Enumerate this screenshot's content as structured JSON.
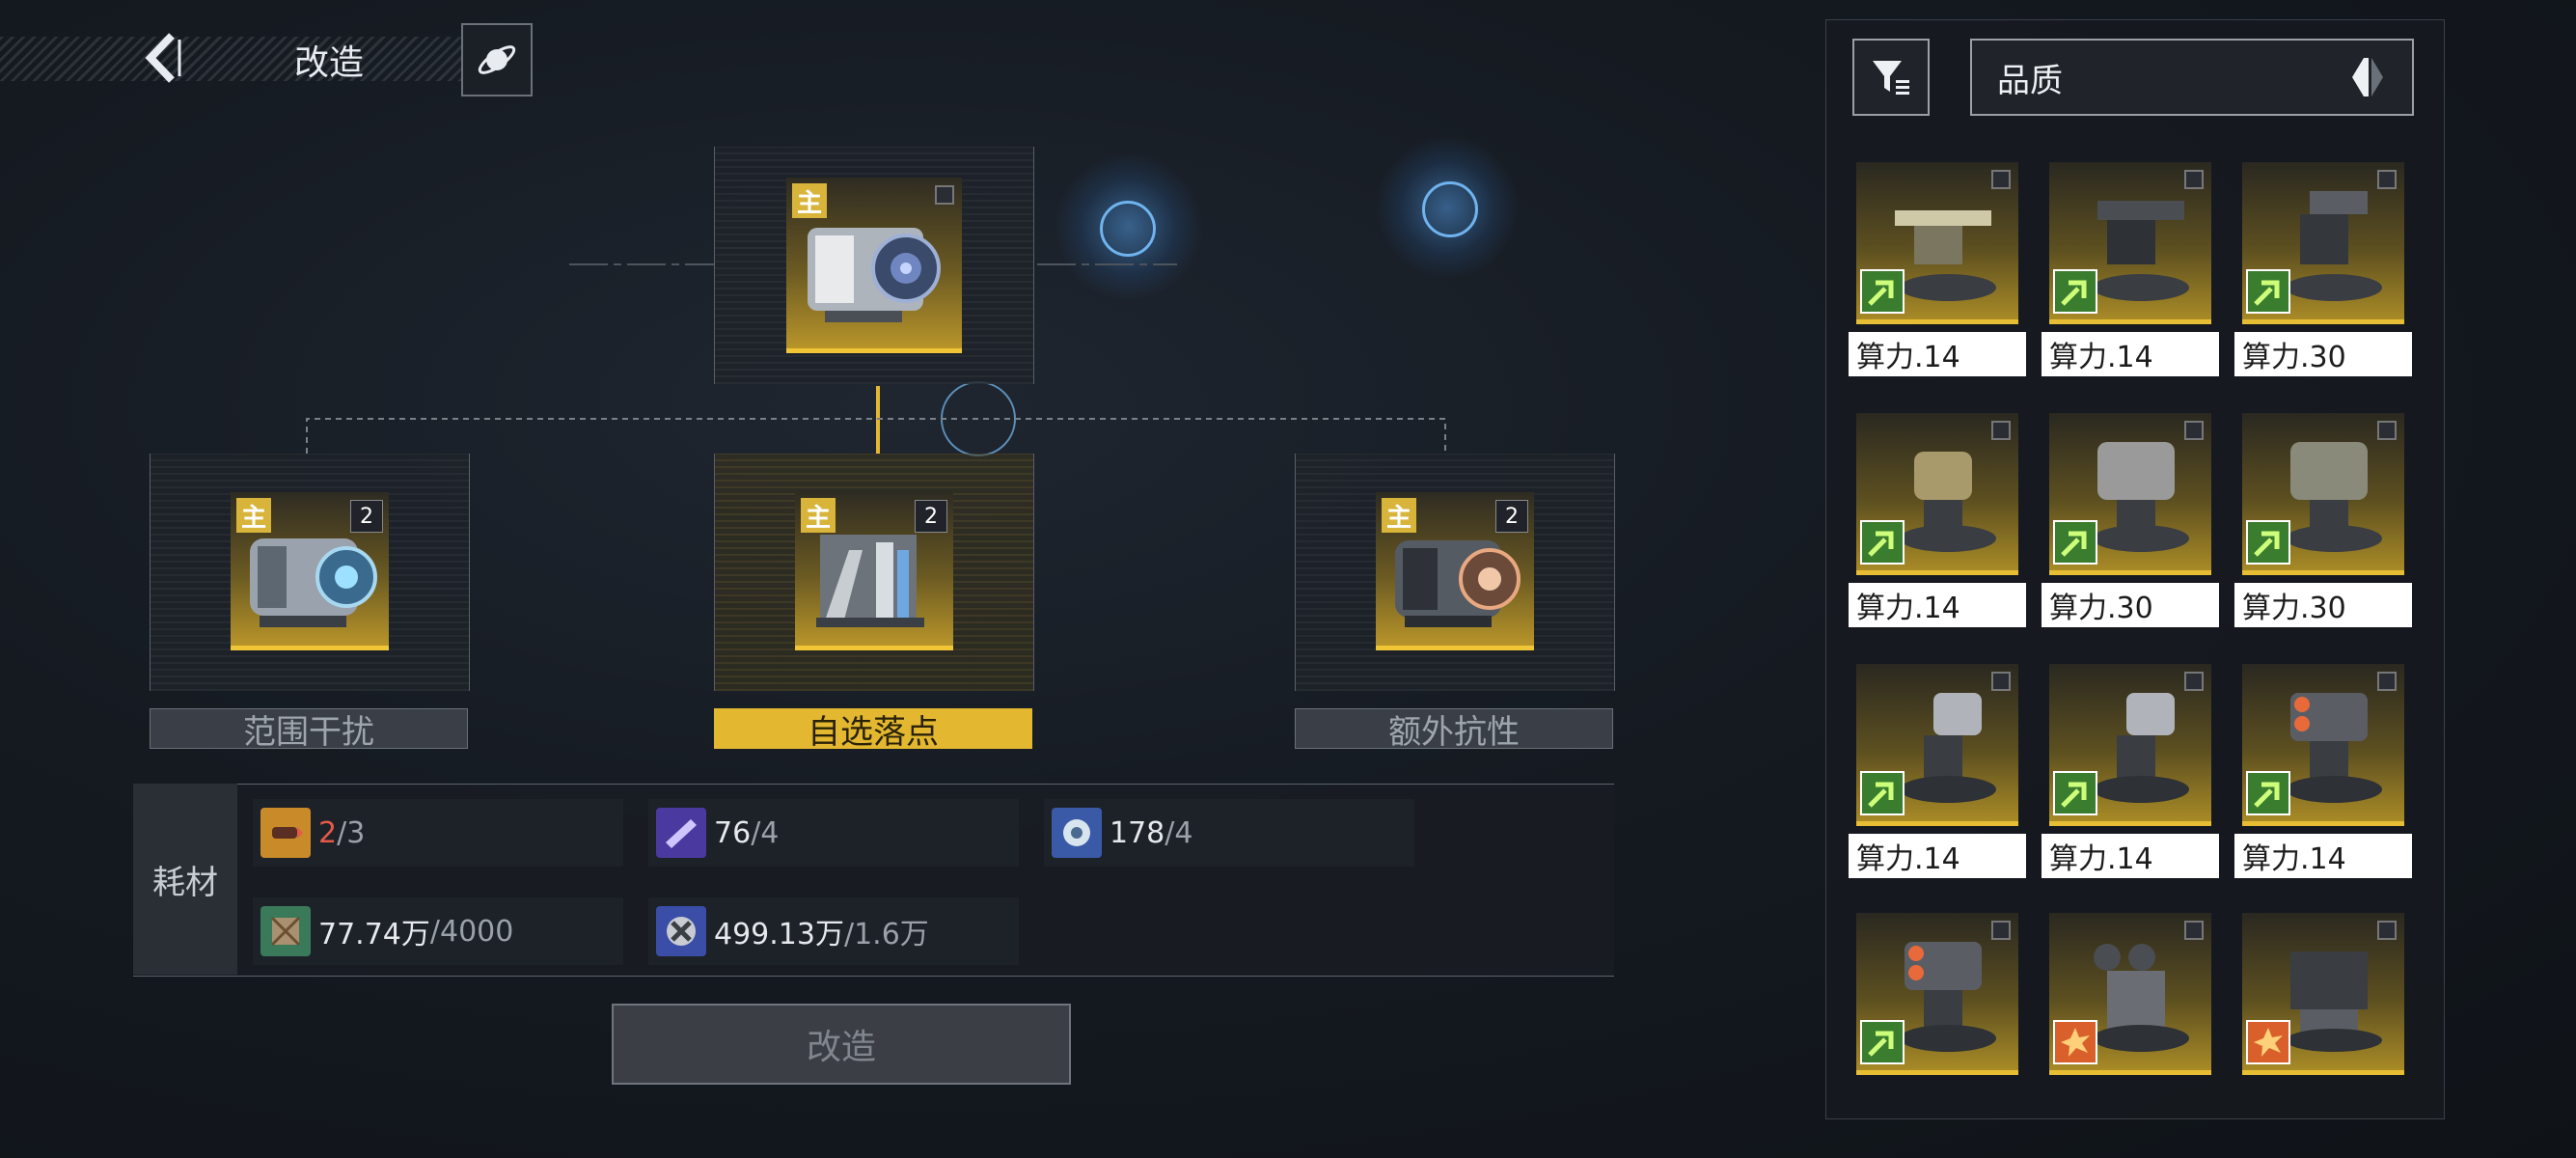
{
  "header": {
    "title": "改造"
  },
  "slots": [
    {
      "label": "范围干扰",
      "main_tag": "主",
      "count": "2",
      "active": false
    },
    {
      "label": "自选落点",
      "main_tag": "主",
      "count": "2",
      "active": true
    },
    {
      "label": "额外抗性",
      "main_tag": "主",
      "count": "2",
      "active": false
    }
  ],
  "top_item": {
    "main_tag": "主"
  },
  "materials": {
    "label": "耗材",
    "items": [
      {
        "have": "2",
        "need": "/3",
        "icon": "missile-icon"
      },
      {
        "have": "76",
        "need": "/4",
        "icon": "crystal-icon"
      },
      {
        "have": "178",
        "need": "/4",
        "icon": "sphere-icon"
      },
      {
        "have": "77.74万",
        "need": "/4000",
        "icon": "crate-icon"
      },
      {
        "have": "499.13万",
        "need": "/1.6万",
        "icon": "cross-icon"
      }
    ]
  },
  "craft_button": {
    "label": "改造"
  },
  "sort": {
    "label": "品质"
  },
  "inventory": [
    {
      "power": "算力.14",
      "badge": "green"
    },
    {
      "power": "算力.14",
      "badge": "green"
    },
    {
      "power": "算力.30",
      "badge": "green"
    },
    {
      "power": "算力.14",
      "badge": "green"
    },
    {
      "power": "算力.30",
      "badge": "green"
    },
    {
      "power": "算力.30",
      "badge": "green"
    },
    {
      "power": "算力.14",
      "badge": "green"
    },
    {
      "power": "算力.14",
      "badge": "green"
    },
    {
      "power": "算力.14",
      "badge": "green"
    },
    {
      "power": "",
      "badge": "green"
    },
    {
      "power": "",
      "badge": "orange"
    },
    {
      "power": "",
      "badge": "orange"
    }
  ],
  "colors": {
    "gold": "#e3b830",
    "red": "#e35a48",
    "green_badge": "#3a7d2e",
    "orange_badge": "#d9602a"
  }
}
